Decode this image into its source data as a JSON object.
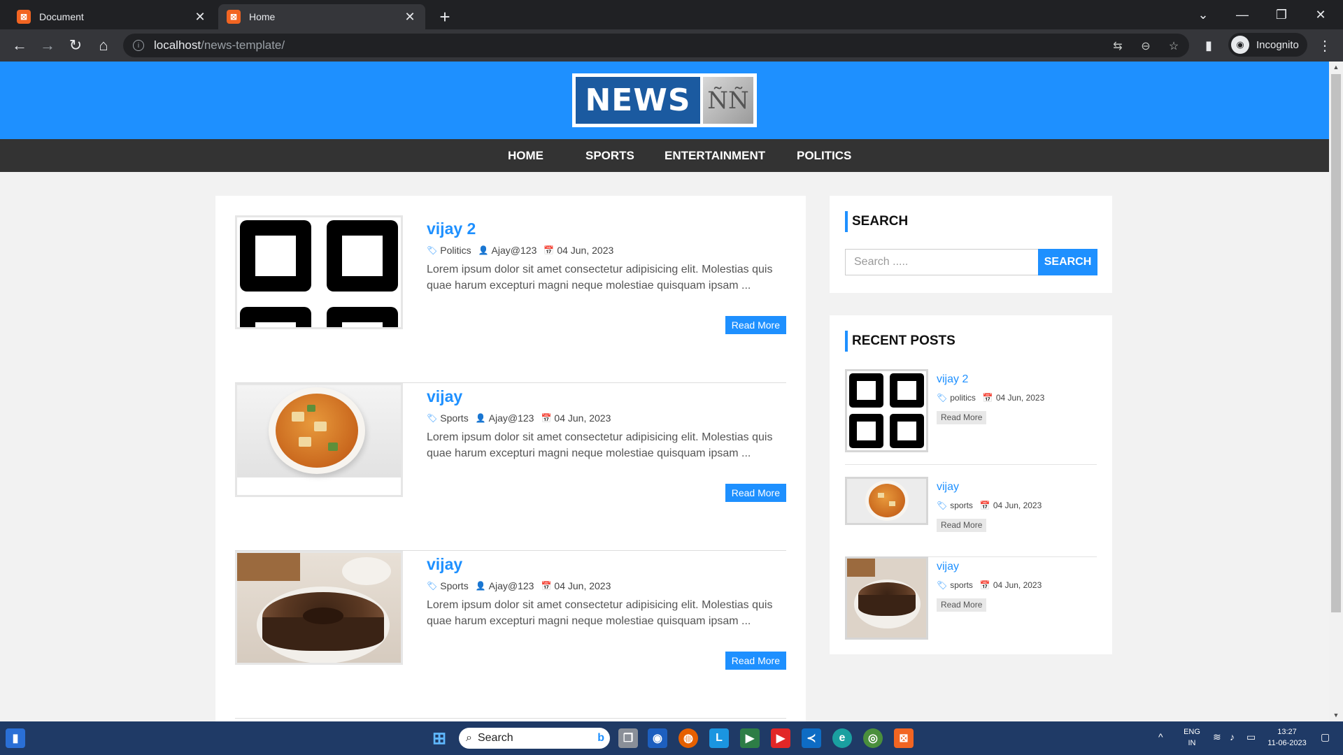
{
  "browser": {
    "tabs": [
      {
        "title": "Document",
        "active": false
      },
      {
        "title": "Home",
        "active": true
      }
    ],
    "url_host": "localhost",
    "url_path": "/news-template/",
    "profile_label": "Incognito"
  },
  "site": {
    "logo_text": "NEWS",
    "logo_mark": "ÑÑ",
    "nav": [
      "HOME",
      "SPORTS",
      "ENTERTAINMENT",
      "POLITICS"
    ],
    "accent_color": "#1e90ff"
  },
  "posts": [
    {
      "title": "vijay 2",
      "category": "Politics",
      "author": "Ajay@123",
      "date": "04 Jun, 2023",
      "excerpt": "Lorem ipsum dolor sit amet consectetur adipisicing elit. Molestias quis quae harum excepturi magni neque molestiae quisquam ipsam ...",
      "read_more": "Read More",
      "image": "qr-icon"
    },
    {
      "title": "vijay",
      "category": "Sports",
      "author": "Ajay@123",
      "date": "04 Jun, 2023",
      "excerpt": "Lorem ipsum dolor sit amet consectetur adipisicing elit. Molestias quis quae harum excepturi magni neque molestiae quisquam ipsam ...",
      "read_more": "Read More",
      "image": "curry-bowl"
    },
    {
      "title": "vijay",
      "category": "Sports",
      "author": "Ajay@123",
      "date": "04 Jun, 2023",
      "excerpt": "Lorem ipsum dolor sit amet consectetur adipisicing elit. Molestias quis quae harum excepturi magni neque molestiae quisquam ipsam ...",
      "read_more": "Read More",
      "image": "chocolate-cake"
    }
  ],
  "sidebar": {
    "search_heading": "SEARCH",
    "search_placeholder": "Search .....",
    "search_button": "SEARCH",
    "recent_heading": "RECENT POSTS",
    "recent": [
      {
        "title": "vijay 2",
        "category": "politics",
        "date": "04 Jun, 2023",
        "button": "Read More",
        "image": "qr-icon"
      },
      {
        "title": "vijay",
        "category": "sports",
        "date": "04 Jun, 2023",
        "button": "Read More",
        "image": "curry-bowl"
      },
      {
        "title": "vijay",
        "category": "sports",
        "date": "04 Jun, 2023",
        "button": "Read More",
        "image": "chocolate-cake"
      }
    ]
  },
  "taskbar": {
    "search_label": "Search",
    "lang_top": "ENG",
    "lang_bottom": "IN",
    "time": "13:27",
    "date": "11-06-2023"
  }
}
